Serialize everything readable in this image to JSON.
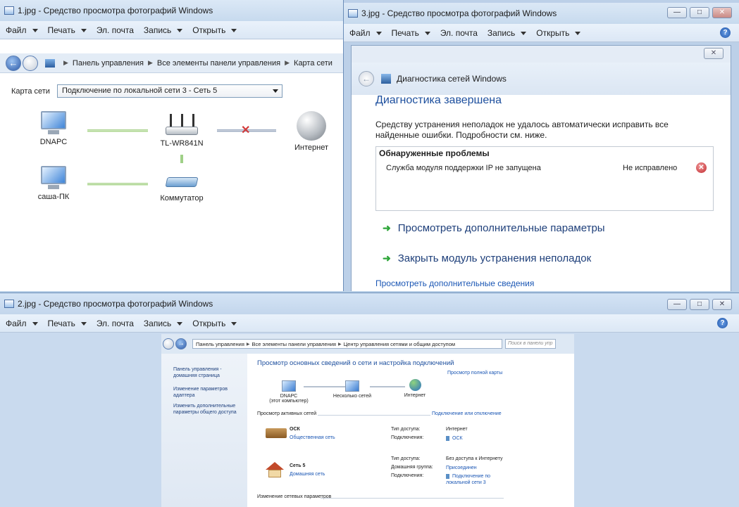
{
  "w1": {
    "title": "1.jpg - Средство просмотра фотографий Windows",
    "menu": [
      "Файл",
      "Печать",
      "Эл. почта",
      "Запись",
      "Открыть"
    ],
    "breadcrumb": [
      "Панель управления",
      "Все элементы панели управления",
      "Карта сети"
    ],
    "map_label": "Карта сети",
    "map_select": "Подключение по локальной сети 3 - Сеть  5",
    "nodes": {
      "dnapc": "DNAPC",
      "router": "TL-WR841N",
      "internet": "Интернет",
      "sasha": "саша-ПК",
      "switch": "Коммутатор"
    }
  },
  "w3": {
    "title": "3.jpg - Средство просмотра фотографий Windows",
    "menu": [
      "Файл",
      "Печать",
      "Эл. почта",
      "Запись",
      "Открыть"
    ],
    "dialog_title": "Диагностика сетей Windows",
    "heading": "Диагностика завершена",
    "message": "Средству устранения неполадок не удалось автоматически исправить все найденные ошибки. Подробности см. ниже.",
    "problems_header": "Обнаруженные проблемы",
    "problem_item": "Служба модуля поддержки IP не запущена",
    "problem_status": "Не исправлено",
    "action_more": "Просмотреть дополнительные параметры",
    "action_close": "Закрыть модуль устранения неполадок",
    "details_link": "Просмотреть дополнительные сведения"
  },
  "w2": {
    "title": "2.jpg - Средство просмотра фотографий Windows",
    "menu": [
      "Файл",
      "Печать",
      "Эл. почта",
      "Запись",
      "Открыть"
    ],
    "breadcrumb": [
      "Панель управления",
      "Все элементы панели управления",
      "Центр управления сетями и общим доступом"
    ],
    "search_placeholder": "Поиск в панели упр",
    "sidebar": [
      "Панель управления - домашняя страница",
      "Изменение параметров адаптера",
      "Изменить дополнительные параметры общего доступа"
    ],
    "main_title": "Просмотр основных сведений о сети и настройка подключений",
    "full_map": "Просмотр полной карты",
    "mini": {
      "pc": "DNAPC",
      "pc_sub": "(этот компьютер)",
      "multi": "Несколько сетей",
      "internet": "Интернет"
    },
    "active_label": "Просмотр активных сетей",
    "connect_link": "Подключение или отключение",
    "net1": {
      "name": "ОСК",
      "type": "Общественная сеть",
      "access_label": "Тип доступа:",
      "access_value": "Интернет",
      "conn_label": "Подключения:",
      "conn_value": "ОСК"
    },
    "net2": {
      "name": "Сеть  5",
      "type": "Домашняя сеть",
      "access_label": "Тип доступа:",
      "access_value": "Без доступа к Интернету",
      "group_label": "Домашняя группа:",
      "group_value": "Присоединен",
      "conn_label": "Подключения:",
      "conn_value": "Подключение по локальной сети 3"
    },
    "change_label": "Изменение сетевых параметров"
  }
}
